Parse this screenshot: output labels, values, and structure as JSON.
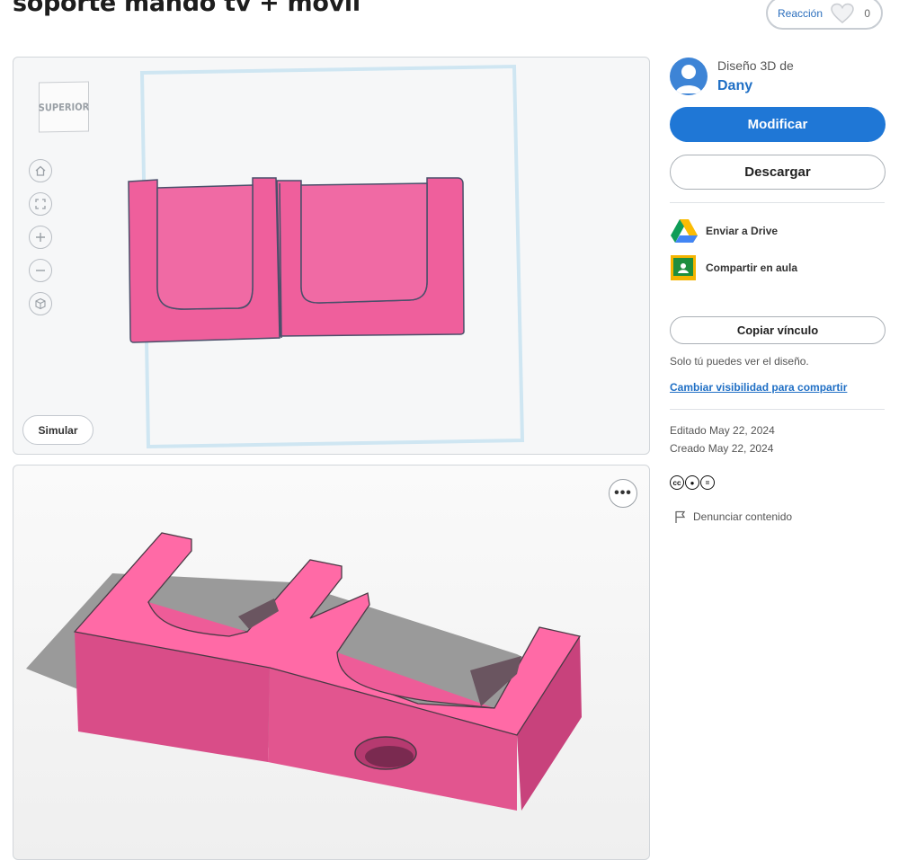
{
  "page": {
    "title": "soporte mando tv + movil",
    "reaction_label": "Reacción",
    "reaction_count": "0"
  },
  "viewer_top": {
    "view_label": "SUPERIOR",
    "tools": [
      "home-icon",
      "fit-icon",
      "zoom-in-icon",
      "zoom-out-icon",
      "view-cube-icon"
    ],
    "simulate_label": "Simular",
    "model_color": "#ef5f9c"
  },
  "viewer_bottom": {
    "more_label": "•••",
    "model_color": "#ff6aa6"
  },
  "sidebar": {
    "design_of": "Diseño 3D de",
    "author": "Dany",
    "modify_label": "Modificar",
    "download_label": "Descargar",
    "share": {
      "drive_label": "Enviar a Drive",
      "classroom_label": "Compartir en aula"
    },
    "copy_link_label": "Copiar vínculo",
    "visibility_note": "Solo tú puedes ver el diseño.",
    "change_visibility_label": "Cambiar visibilidad para compartir",
    "edited": "Editado May 22, 2024",
    "created": "Creado May 22, 2024",
    "license_icons": [
      "cc",
      "by",
      "nd"
    ],
    "report_label": "Denunciar contenido"
  },
  "colors": {
    "accent": "#1f77d6",
    "link": "#1f6fc5",
    "model_pink": "#ef5f9c"
  }
}
